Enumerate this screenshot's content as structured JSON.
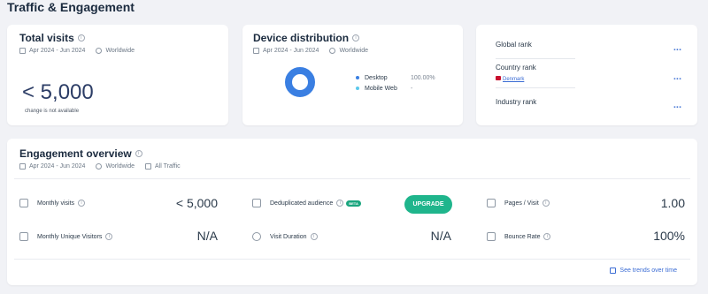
{
  "page": {
    "title": "Traffic & Engagement"
  },
  "total_visits": {
    "title": "Total visits",
    "date_range": "Apr 2024 - Jun 2024",
    "region": "Worldwide",
    "value": "< 5,000",
    "note": "change is not available"
  },
  "device_distribution": {
    "title": "Device distribution",
    "date_range": "Apr 2024 - Jun 2024",
    "region": "Worldwide",
    "items": [
      {
        "label": "Desktop",
        "value": "100.00%",
        "color": "#3a7fe2"
      },
      {
        "label": "Mobile Web",
        "value": "-",
        "color": "#5bc8ec"
      }
    ]
  },
  "ranks": {
    "items": [
      {
        "label": "Global rank",
        "value": "..."
      },
      {
        "label": "Country rank",
        "sublabel": "Denmark",
        "value": "..."
      },
      {
        "label": "Industry rank",
        "value": "..."
      }
    ]
  },
  "engagement": {
    "title": "Engagement overview",
    "date_range": "Apr 2024 - Jun 2024",
    "region": "Worldwide",
    "traffic": "All Traffic",
    "metrics": {
      "monthly_visits": {
        "label": "Monthly visits",
        "value": "< 5,000"
      },
      "monthly_unique": {
        "label": "Monthly Unique Visitors",
        "value": "N/A"
      },
      "dedup_audience": {
        "label": "Deduplicated audience",
        "badge": "BETA"
      },
      "visit_duration": {
        "label": "Visit Duration",
        "value": "N/A"
      },
      "pages_per_visit": {
        "label": "Pages / Visit",
        "value": "1.00"
      },
      "bounce_rate": {
        "label": "Bounce Rate",
        "value": "100%"
      }
    },
    "upgrade_label": "UPGRADE",
    "trends_link": "See trends over time"
  },
  "colors": {
    "accent": "#3a7fe2",
    "upgrade": "#1fb58c",
    "link": "#3b6cd4"
  }
}
